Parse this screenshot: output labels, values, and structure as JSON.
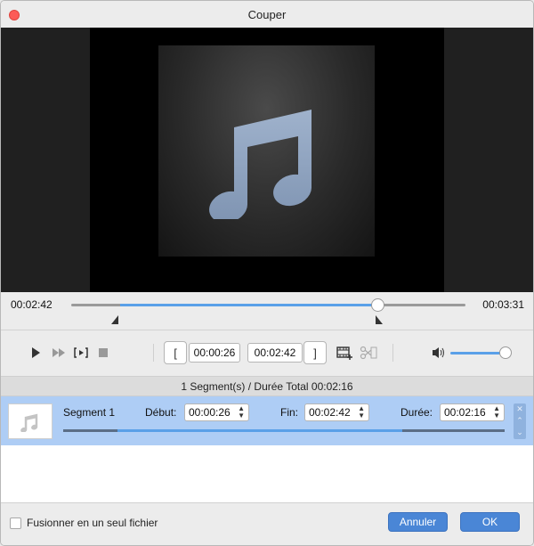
{
  "window": {
    "title": "Couper"
  },
  "timeline": {
    "current_time": "00:02:42",
    "total_time": "00:03:31",
    "playhead_fraction": 0.776,
    "selection_start_fraction": 0.124,
    "selection_end_fraction": 0.776
  },
  "controls": {
    "start_time": "00:00:26",
    "end_time": "00:02:42",
    "start_bracket": "[",
    "end_bracket": "]",
    "volume_fraction": 0.9,
    "icons": [
      "play-icon",
      "fast-forward-icon",
      "segment-play-icon",
      "stop-icon",
      "add-segment-icon",
      "split-icon",
      "volume-icon"
    ]
  },
  "summary": "1 Segment(s) / Durée Total 00:02:16",
  "segments": [
    {
      "name": "Segment 1",
      "start_label": "Début:",
      "start": "00:00:26",
      "end_label": "Fin:",
      "end": "00:02:42",
      "duration_label": "Durée:",
      "duration": "00:02:16"
    }
  ],
  "footer": {
    "merge_label": "Fusionner en un seul fichier",
    "cancel_label": "Annuler",
    "ok_label": "OK"
  },
  "colors": {
    "accent": "#5aa0e8",
    "selection_row": "#aecdf5",
    "button": "#4a86d6"
  }
}
